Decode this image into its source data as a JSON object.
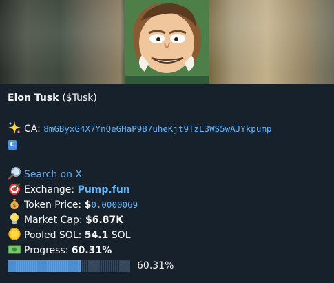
{
  "token": {
    "name": "Elon Tusk",
    "ticker": "($Tusk)",
    "ca_label": "CA:",
    "ca": "8mGByxG4X7YnQeGHaP9B7uheKjt9TzL3WS5wAJYkpump",
    "copy_label": "C"
  },
  "details": {
    "search_link": "Search on X",
    "exchange_label": "Exchange:",
    "exchange_value": "Pump.fun",
    "price_label": "Token Price:",
    "price_prefix": "$",
    "price_value": "0.0000069",
    "mcap_label": "Market Cap:",
    "mcap_value": "$6.87K",
    "pooled_label": "Pooled SOL:",
    "pooled_value": "54.1",
    "pooled_unit": "SOL",
    "progress_label": "Progress:",
    "progress_value": "60.31%",
    "progress_fraction": 0.6031,
    "progress_text": "60.31%"
  },
  "icons": {
    "ca": "sparkle-icon",
    "search": "magnifier-icon",
    "exchange": "target-icon",
    "price": "money-bag-icon",
    "mcap": "light-bulb-icon",
    "pooled": "coin-icon",
    "progress": "banknote-icon"
  },
  "colors": {
    "background": "#17212b",
    "link": "#6ab3f3",
    "text": "#f5f5f5",
    "progress_fill": "#5aa0e0"
  }
}
